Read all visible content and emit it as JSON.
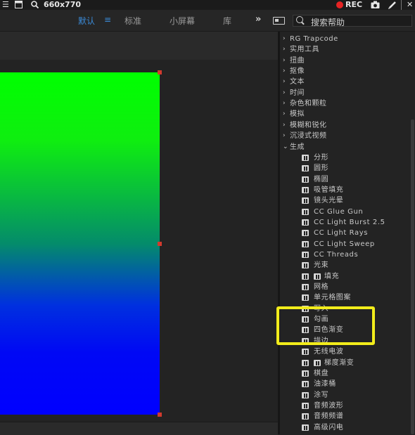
{
  "recbar": {
    "window_size": "660x770",
    "rec_label": "REC",
    "icons": [
      "hamburger-icon",
      "window-icon",
      "search-icon",
      "record-icon",
      "camera-icon",
      "pen-icon",
      "separator",
      "close-icon"
    ]
  },
  "toolbar": {
    "workspaces": [
      {
        "label": "默认",
        "active": true
      },
      {
        "label": "标准",
        "active": false
      },
      {
        "label": "小屏幕",
        "active": false
      },
      {
        "label": "库",
        "active": false
      }
    ],
    "menu_glyph": "≡",
    "more_glyph": "»",
    "search_placeholder": "搜索帮助"
  },
  "effects": {
    "categories_before": [
      "RG Trapcode",
      "实用工具",
      "扭曲",
      "抠像",
      "文本",
      "时间",
      "杂色和颗粒",
      "模拟",
      "模糊和锐化",
      "沉浸式视频"
    ],
    "open_category": "生成",
    "items": [
      {
        "label": "分形",
        "double": false
      },
      {
        "label": "圆形",
        "double": false
      },
      {
        "label": "椭圆",
        "double": false
      },
      {
        "label": "吸管填充",
        "double": false
      },
      {
        "label": "镜头光晕",
        "double": false
      },
      {
        "label": "CC Glue Gun",
        "double": false
      },
      {
        "label": "CC Light Burst 2.5",
        "double": false
      },
      {
        "label": "CC Light Rays",
        "double": false
      },
      {
        "label": "CC Light Sweep",
        "double": false
      },
      {
        "label": "CC Threads",
        "double": false
      },
      {
        "label": "光束",
        "double": false
      },
      {
        "label": "填充",
        "double": true
      },
      {
        "label": "网格",
        "double": false
      },
      {
        "label": "单元格图案",
        "double": false
      },
      {
        "label": "写入",
        "double": false
      },
      {
        "label": "勾画",
        "double": false
      },
      {
        "label": "四色渐变",
        "double": false
      },
      {
        "label": "描边",
        "double": false
      },
      {
        "label": "无线电波",
        "double": false
      },
      {
        "label": "梯度渐变",
        "double": true
      },
      {
        "label": "棋盘",
        "double": false
      },
      {
        "label": "油漆桶",
        "double": false
      },
      {
        "label": "涂写",
        "double": false
      },
      {
        "label": "音频波形",
        "double": false
      },
      {
        "label": "音频频谱",
        "double": false
      },
      {
        "label": "高级闪电",
        "double": false
      }
    ]
  },
  "colors": {
    "accent": "#3b8bd8",
    "rec": "#e52323",
    "highlight_box": "#f2ec1b",
    "gradient_top": "#00ff00",
    "gradient_bottom": "#0000ff"
  }
}
